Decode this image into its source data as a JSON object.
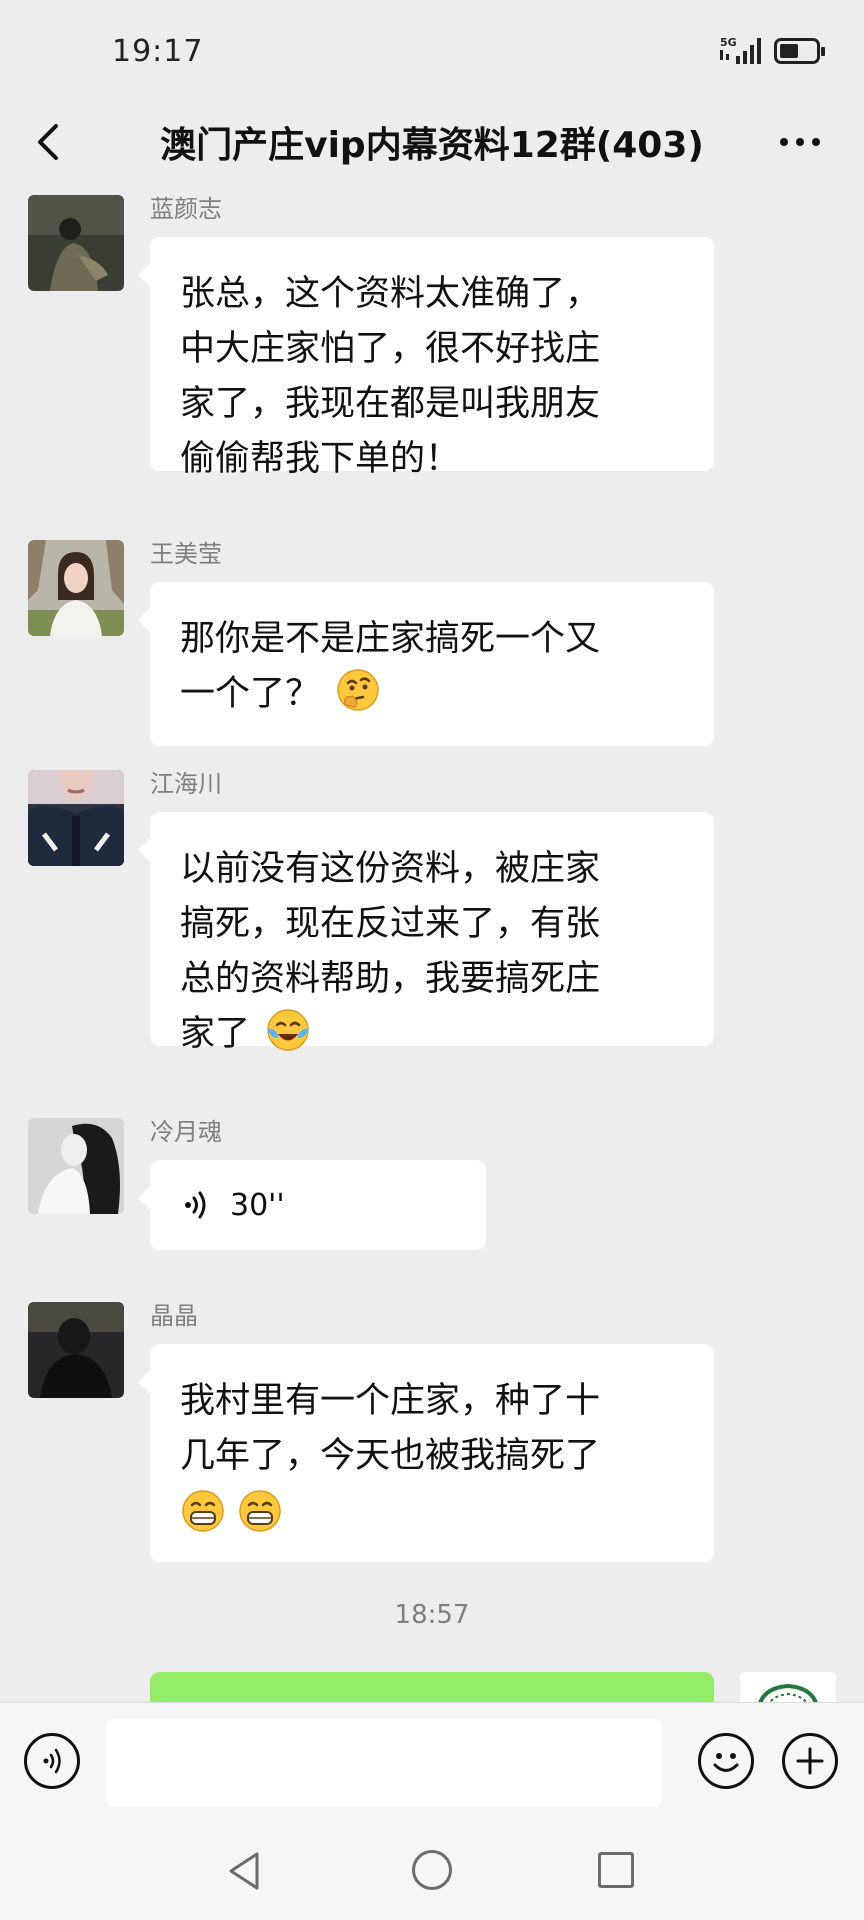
{
  "status_bar": {
    "time": "19:17",
    "network": "5G"
  },
  "header": {
    "title": "澳门产庄vip内幕资料12群(403)"
  },
  "messages": [
    {
      "sender": "蓝颜志",
      "lines": [
        "张总，这个资料太准确了，",
        "中大庄家怕了，很不好找庄",
        "家了，我现在都是叫我朋友",
        "偷偷帮我下单的！"
      ],
      "avatar": "man-sitting-dark-avatar"
    },
    {
      "sender": "王美莹",
      "lines": [
        "那你是不是庄家搞死一个又",
        "一个了？"
      ],
      "emoji": "thinking-face-emoji",
      "avatar": "woman-outdoor-avatar"
    },
    {
      "sender": "江海川",
      "lines": [
        "以前没有这份资料，被庄家",
        "搞死，现在反过来了，有张",
        "总的资料帮助，我要搞死庄",
        "家了"
      ],
      "emoji": "crying-laughing-emoji",
      "avatar": "person-jacket-avatar"
    },
    {
      "sender": "冷月魂",
      "voice_duration": "30''",
      "avatar": "woman-bw-avatar"
    },
    {
      "sender": "晶晶",
      "lines": [
        "我村里有一个庄家，种了十",
        "几年了，今天也被我搞死了"
      ],
      "emoji": "grinning-emoji",
      "avatar": "person-dark-avatar"
    }
  ],
  "timestamp": "18:57",
  "input": {
    "placeholder": ""
  },
  "colors": {
    "background": "#ededed",
    "bubble": "#ffffff",
    "own_bubble": "#95ec69",
    "sender": "#7f7f7f"
  }
}
